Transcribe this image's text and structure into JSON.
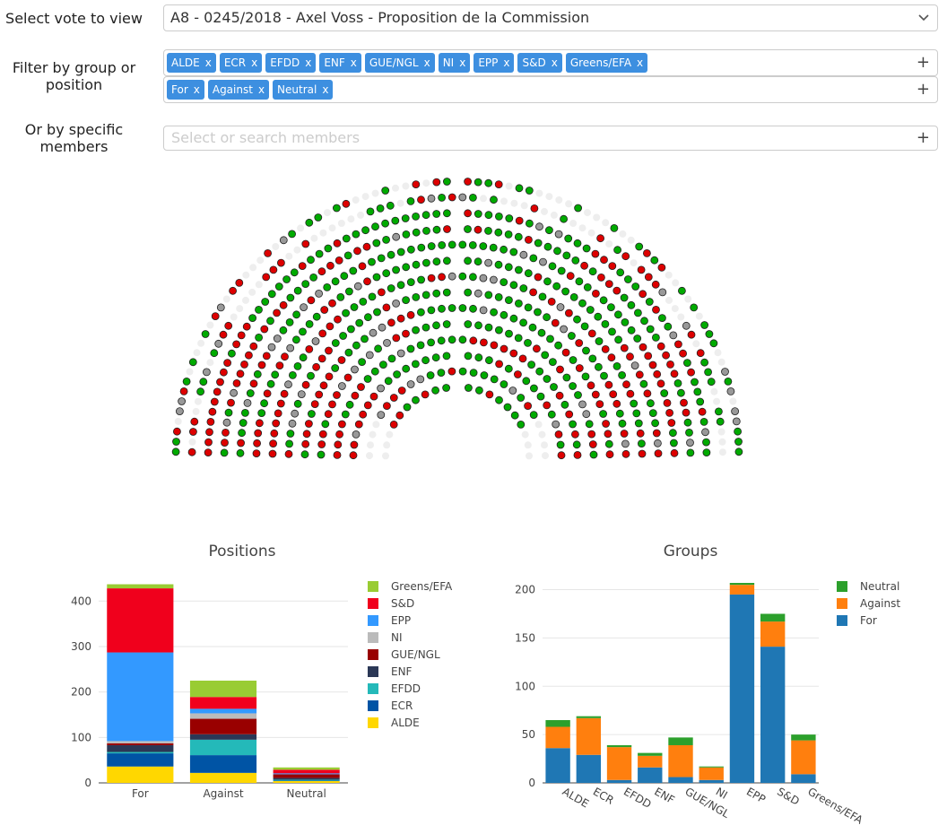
{
  "controls": {
    "vote_label": "Select vote to view",
    "vote_value": "A8 - 0245/2018 - Axel Voss - Proposition de la Commission",
    "filter_label_line1": "Filter by group or",
    "filter_label_line2": "position",
    "group_tags": [
      "ALDE",
      "ECR",
      "EFDD",
      "ENF",
      "GUE/NGL",
      "NI",
      "EPP",
      "S&D",
      "Greens/EFA"
    ],
    "position_tags": [
      "For",
      "Against",
      "Neutral"
    ],
    "tag_remove": "x",
    "add_symbol": "+",
    "members_label_line1": "Or by specific",
    "members_label_line2": "members",
    "members_placeholder": "Select or search members"
  },
  "hemicycle": {
    "colors": {
      "for": "#00aa00",
      "against": "#dd0000",
      "neutral": "#999999",
      "absent": "#eeeeee"
    },
    "icon": "seat-dot"
  },
  "colors": {
    "ALDE": "#ffd700",
    "ECR": "#0054a5",
    "EFDD": "#24b9b9",
    "ENF": "#2b3856",
    "GUE/NGL": "#990000",
    "NI": "#bbbbbb",
    "EPP": "#3399ff",
    "S&D": "#f0001c",
    "Greens/EFA": "#99cc33",
    "Neutral": "#2ca02c",
    "Against": "#ff7f0e",
    "For": "#1f77b4"
  },
  "chart_data": [
    {
      "type": "bar",
      "stacked": true,
      "title": "Positions",
      "categories": [
        "For",
        "Against",
        "Neutral"
      ],
      "ylim": [
        0,
        440
      ],
      "yticks": [
        0,
        100,
        200,
        300,
        400
      ],
      "legend": "right",
      "series": [
        {
          "name": "ALDE",
          "values": [
            36,
            22,
            4
          ]
        },
        {
          "name": "ECR",
          "values": [
            29,
            39,
            1
          ]
        },
        {
          "name": "EFDD",
          "values": [
            3,
            34,
            2
          ]
        },
        {
          "name": "ENF",
          "values": [
            15,
            12,
            4
          ]
        },
        {
          "name": "GUE/NGL",
          "values": [
            4,
            34,
            8
          ]
        },
        {
          "name": "NI",
          "values": [
            5,
            12,
            0
          ]
        },
        {
          "name": "EPP",
          "values": [
            195,
            10,
            2
          ]
        },
        {
          "name": "S&D",
          "values": [
            141,
            26,
            8
          ]
        },
        {
          "name": "Greens/EFA",
          "values": [
            9,
            36,
            5
          ]
        }
      ]
    },
    {
      "type": "bar",
      "stacked": true,
      "title": "Groups",
      "categories": [
        "ALDE",
        "ECR",
        "EFDD",
        "ENF",
        "GUE/NGL",
        "NI",
        "EPP",
        "S&D",
        "Greens/EFA"
      ],
      "ylim": [
        0,
        207
      ],
      "yticks": [
        0,
        50,
        100,
        150,
        200
      ],
      "legend": "right",
      "series": [
        {
          "name": "For",
          "values": [
            36,
            29,
            3,
            16,
            6,
            3,
            195,
            141,
            9
          ]
        },
        {
          "name": "Against",
          "values": [
            22,
            38,
            34,
            12,
            33,
            13,
            10,
            26,
            35
          ]
        },
        {
          "name": "Neutral",
          "values": [
            7,
            2,
            2,
            3,
            8,
            1,
            2,
            8,
            6
          ]
        }
      ]
    }
  ]
}
